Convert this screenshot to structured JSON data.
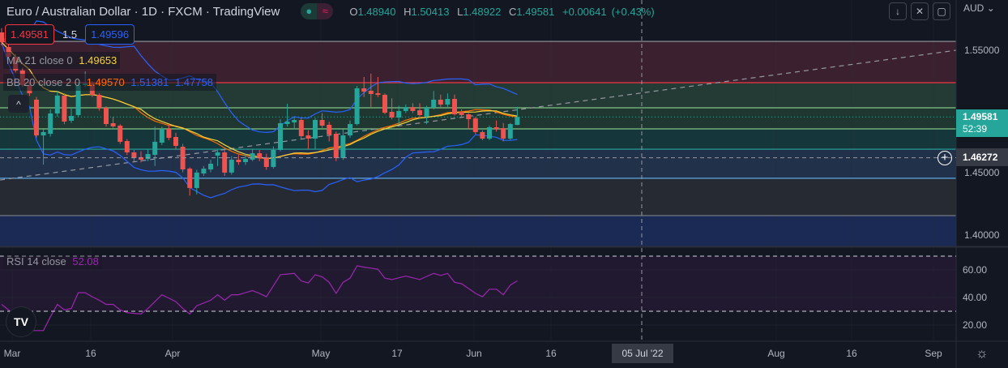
{
  "header": {
    "title": "Euro / Australian Dollar · 1D · FXCM · TradingView",
    "status_icons": [
      "market-open-dot-icon",
      "delayed-data-icon"
    ],
    "ohlc": {
      "o_label": "O",
      "o": "1.48940",
      "h_label": "H",
      "h": "1.50413",
      "l_label": "L",
      "l": "1.48922",
      "c_label": "C",
      "c": "1.49581",
      "change": "+0.00641",
      "change_pct": "(+0.43%)"
    }
  },
  "trade": {
    "sell": "1.49581",
    "qty": "1.5",
    "buy": "1.49596"
  },
  "legend": {
    "ma": {
      "name": "MA 21 close 0",
      "value": "1.49653"
    },
    "bb": {
      "name": "BB 20 close 2 0",
      "basis": "1.49570",
      "upper": "1.51381",
      "lower": "1.47758"
    },
    "rsi": {
      "name": "RSI 14 close",
      "value": "52.08"
    }
  },
  "toolbar": {
    "icons": [
      "arrow-down-icon",
      "collapse-icon",
      "fullscreen-icon"
    ],
    "currency": "AUD"
  },
  "price_axis": {
    "ticks": [
      "1.55000",
      "1.45000",
      "1.40000"
    ],
    "current_price": "1.49581",
    "countdown": "52:39",
    "crosshair_price": "1.46272"
  },
  "rsi_axis": {
    "ticks": [
      "60.00",
      "40.00",
      "20.00"
    ]
  },
  "time_axis": {
    "ticks": [
      "Mar",
      "16",
      "Apr",
      "May",
      "17",
      "Jun",
      "16",
      "Aug",
      "16",
      "Sep"
    ],
    "crosshair_date": "05 Jul '22"
  },
  "colors": {
    "background": "#131722",
    "up": "#26a69a",
    "down": "#ef5350",
    "ma": "#f5d33d",
    "bb_basis": "#ff6d00",
    "bb_bands": "#2962ff",
    "rsi": "#9c27b0"
  },
  "chart_data": {
    "type": "candlestick",
    "symbol": "EURAUD",
    "interval": "1D",
    "ylim": [
      1.3925,
      1.5795
    ],
    "rsi_ylim": [
      0,
      100
    ],
    "rsi_levels": [
      70,
      30
    ],
    "price_levels": [
      1.5572,
      1.5237,
      1.5033,
      1.4862,
      1.4697,
      1.4461,
      1.4158
    ],
    "trendline": [
      [
        0,
        1.4447
      ],
      [
        1180,
        1.55
      ]
    ],
    "candles": [
      [
        1.5645,
        1.568,
        1.554,
        1.5566
      ],
      [
        1.5526,
        1.556,
        1.543,
        1.5447
      ],
      [
        1.5447,
        1.547,
        1.532,
        1.5336
      ],
      [
        1.5336,
        1.536,
        1.52,
        1.5217
      ],
      [
        1.5217,
        1.524,
        1.513,
        1.5151
      ],
      [
        1.5099,
        1.512,
        1.479,
        1.4809
      ],
      [
        1.4809,
        1.486,
        1.4572,
        1.4836
      ],
      [
        1.4822,
        1.502,
        1.48,
        1.4987
      ],
      [
        1.4987,
        1.517,
        1.496,
        1.5132
      ],
      [
        1.5132,
        1.515,
        1.49,
        1.4921
      ],
      [
        1.4928,
        1.504,
        1.491,
        1.4967
      ],
      [
        1.4974,
        1.524,
        1.496,
        1.5217
      ],
      [
        1.5217,
        1.5329,
        1.52,
        1.523
      ],
      [
        1.5237,
        1.525,
        1.512,
        1.5138
      ],
      [
        1.5138,
        1.515,
        1.501,
        1.5033
      ],
      [
        1.5033,
        1.5045,
        1.488,
        1.4901
      ],
      [
        1.4908,
        1.496,
        1.487,
        1.4882
      ],
      [
        1.4888,
        1.49,
        1.474,
        1.4757
      ],
      [
        1.4763,
        1.478,
        1.465,
        1.4671
      ],
      [
        1.4671,
        1.469,
        1.46,
        1.4625
      ],
      [
        1.4632,
        1.468,
        1.459,
        1.4612
      ],
      [
        1.4618,
        1.47,
        1.46,
        1.4658
      ],
      [
        1.4651,
        1.488,
        1.456,
        1.4757
      ],
      [
        1.475,
        1.488,
        1.473,
        1.4862
      ],
      [
        1.4862,
        1.49,
        1.477,
        1.4789
      ],
      [
        1.4796,
        1.483,
        1.47,
        1.4724
      ],
      [
        1.4717,
        1.474,
        1.451,
        1.4533
      ],
      [
        1.4539,
        1.455,
        1.432,
        1.4382
      ],
      [
        1.4382,
        1.453,
        1.433,
        1.4507
      ],
      [
        1.45,
        1.456,
        1.448,
        1.4539
      ],
      [
        1.4533,
        1.461,
        1.451,
        1.4579
      ],
      [
        1.4645,
        1.47,
        1.456,
        1.4671
      ],
      [
        1.4671,
        1.469,
        1.448,
        1.4507
      ],
      [
        1.4507,
        1.464,
        1.449,
        1.4612
      ],
      [
        1.4612,
        1.465,
        1.457,
        1.4592
      ],
      [
        1.4592,
        1.466,
        1.457,
        1.4618
      ],
      [
        1.4612,
        1.47,
        1.46,
        1.4664
      ],
      [
        1.4664,
        1.469,
        1.46,
        1.4625
      ],
      [
        1.4632,
        1.466,
        1.453,
        1.4553
      ],
      [
        1.4553,
        1.472,
        1.454,
        1.4691
      ],
      [
        1.4691,
        1.494,
        1.468,
        1.4908
      ],
      [
        1.4901,
        1.5066,
        1.488,
        1.4921
      ],
      [
        1.4914,
        1.496,
        1.486,
        1.4934
      ],
      [
        1.4934,
        1.495,
        1.478,
        1.4803
      ],
      [
        1.4809,
        1.485,
        1.47,
        1.4783
      ],
      [
        1.4783,
        1.495,
        1.47,
        1.4934
      ],
      [
        1.4934,
        1.499,
        1.487,
        1.4888
      ],
      [
        1.4895,
        1.492,
        1.476,
        1.4816
      ],
      [
        1.4822,
        1.484,
        1.46,
        1.4625
      ],
      [
        1.4625,
        1.486,
        1.461,
        1.4809
      ],
      [
        1.4809,
        1.493,
        1.479,
        1.4901
      ],
      [
        1.4901,
        1.521,
        1.489,
        1.5191
      ],
      [
        1.5191,
        1.5283,
        1.512,
        1.5164
      ],
      [
        1.5171,
        1.531,
        1.504,
        1.5145
      ],
      [
        1.5151,
        1.5283,
        1.512,
        1.5138
      ],
      [
        1.5138,
        1.515,
        1.498,
        1.4993
      ],
      [
        1.5,
        1.511,
        1.494,
        1.4954
      ],
      [
        1.4954,
        1.505,
        1.49,
        1.5007
      ],
      [
        1.5007,
        1.506,
        1.499,
        1.5039
      ],
      [
        1.5039,
        1.507,
        1.499,
        1.5007
      ],
      [
        1.5013,
        1.507,
        1.495,
        1.4974
      ],
      [
        1.4961,
        1.505,
        1.49,
        1.5033
      ],
      [
        1.5033,
        1.517,
        1.502,
        1.5099
      ],
      [
        1.5099,
        1.514,
        1.504,
        1.5059
      ],
      [
        1.5059,
        1.515,
        1.504,
        1.5105
      ],
      [
        1.5105,
        1.514,
        1.497,
        1.498
      ],
      [
        1.5,
        1.502,
        1.495,
        1.4974
      ],
      [
        1.498,
        1.499,
        1.486,
        1.4941
      ],
      [
        1.4947,
        1.496,
        1.482,
        1.4836
      ],
      [
        1.4836,
        1.485,
        1.477,
        1.4783
      ],
      [
        1.4783,
        1.489,
        1.477,
        1.4875
      ],
      [
        1.4875,
        1.493,
        1.484,
        1.4862
      ],
      [
        1.4868,
        1.491,
        1.476,
        1.4783
      ],
      [
        1.4783,
        1.491,
        1.477,
        1.4901
      ],
      [
        1.4894,
        1.50413,
        1.48922,
        1.49581
      ]
    ],
    "rsi": [
      35,
      31,
      26,
      21,
      16,
      16,
      16,
      26,
      35,
      31,
      32,
      43.5,
      43.5,
      40.5,
      38,
      35,
      35,
      31,
      29,
      28.5,
      28,
      32,
      37,
      42,
      39.5,
      37,
      32,
      28,
      34,
      36,
      38,
      42,
      38,
      42,
      42,
      43.5,
      45,
      43,
      40.5,
      48.5,
      56.5,
      57,
      57.5,
      52,
      50.5,
      56.5,
      55,
      51,
      43,
      51,
      54,
      63,
      62,
      61.3,
      60.5,
      54,
      53,
      54.3,
      55.5,
      54.3,
      53,
      55.3,
      57.5,
      56,
      57.5,
      51,
      50,
      46.5,
      43,
      40.5,
      46,
      46,
      42,
      49,
      52.08
    ]
  }
}
